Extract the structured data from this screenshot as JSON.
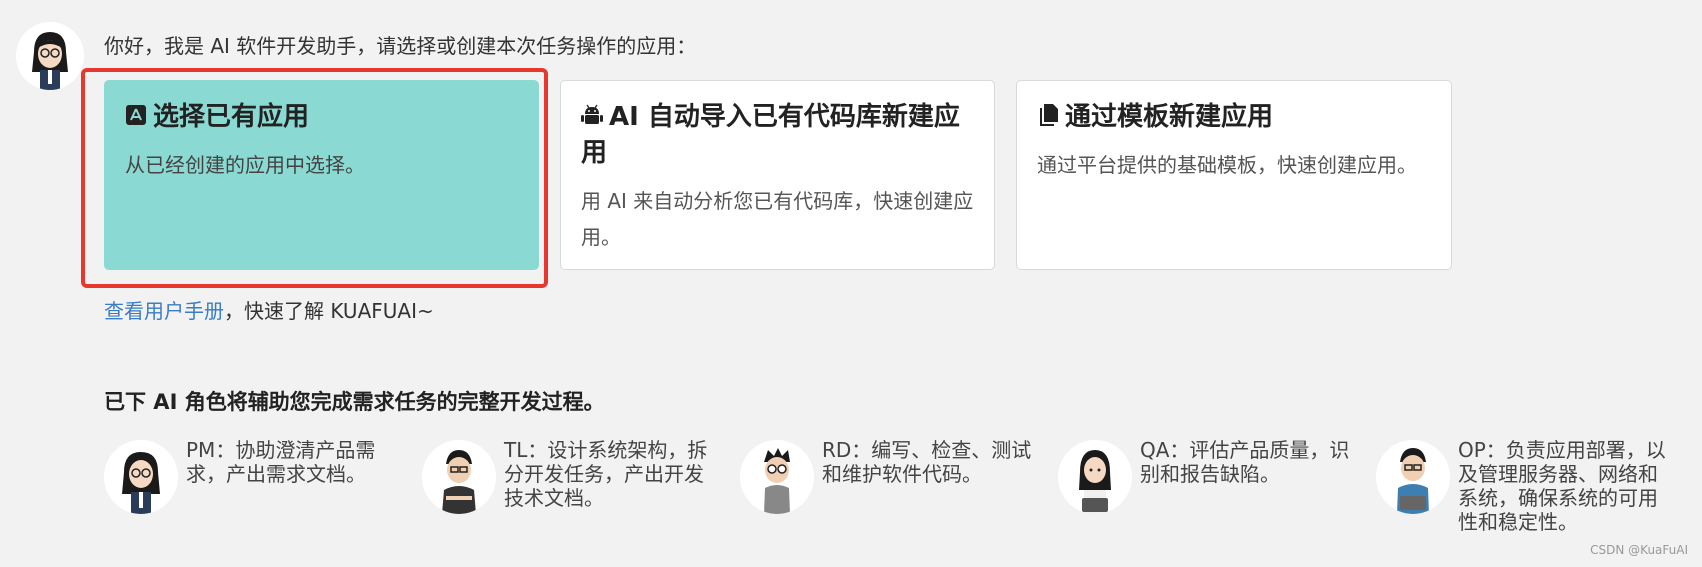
{
  "greeting": "你好，我是 AI 软件开发助手，请选择或创建本次任务操作的应用：",
  "cards": [
    {
      "icon": "app-store-icon",
      "title": "选择已有应用",
      "desc": "从已经创建的应用中选择。",
      "selected": true
    },
    {
      "icon": "android-icon",
      "title": "AI 自动导入已有代码库新建应用",
      "desc": "用 AI 来自动分析您已有代码库，快速创建应用。",
      "selected": false
    },
    {
      "icon": "document-icon",
      "title": "通过模板新建应用",
      "desc": "通过平台提供的基础模板，快速创建应用。",
      "selected": false
    }
  ],
  "manual": {
    "link_text": "查看用户手册",
    "suffix": "，快速了解 KUAFUAI~"
  },
  "roles_heading": "已下 AI 角色将辅助您完成需求任务的完整开发过程。",
  "roles": [
    {
      "code": "PM",
      "text": "PM：协助澄清产品需求，产出需求文档。"
    },
    {
      "code": "TL",
      "text": "TL：设计系统架构，拆分开发任务，产出开发技术文档。"
    },
    {
      "code": "RD",
      "text": "RD：编写、检查、测试和维护软件代码。"
    },
    {
      "code": "QA",
      "text": "QA：评估产品质量，识别和报告缺陷。"
    },
    {
      "code": "OP",
      "text": "OP：负责应用部署，以及管理服务器、网络和系统，确保系统的可用性和稳定性。"
    }
  ],
  "watermark": "CSDN @KuaFuAI",
  "colors": {
    "selected_card": "#8ad9d2",
    "highlight_border": "#e8372c",
    "link": "#3b7dc4"
  }
}
